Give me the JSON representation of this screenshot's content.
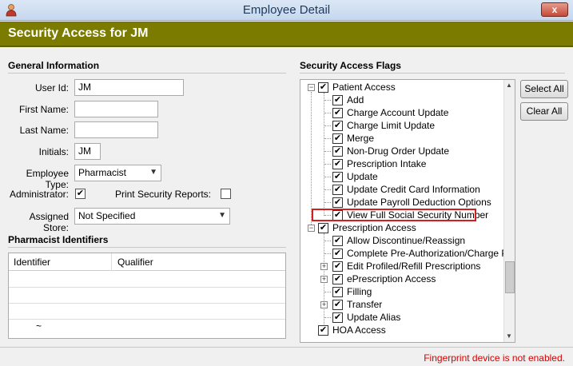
{
  "window": {
    "title": "Employee Detail",
    "close_glyph": "x"
  },
  "header": {
    "title": "Security Access for JM"
  },
  "general": {
    "section_title": "General Information",
    "user_id_label": "User Id:",
    "user_id": "JM",
    "first_name_label": "First Name:",
    "first_name": "",
    "last_name_label": "Last Name:",
    "last_name": "",
    "initials_label": "Initials:",
    "initials": "JM",
    "employee_type_label": "Employee Type:",
    "employee_type": "Pharmacist",
    "administrator_label": "Administrator:",
    "administrator_checked": "✔",
    "print_reports_label": "Print Security Reports:",
    "print_reports_checked": "",
    "assigned_store_label": "Assigned Store:",
    "assigned_store": "Not Specified"
  },
  "identifiers": {
    "section_title": "Pharmacist Identifiers",
    "columns": [
      "Identifier",
      "Qualifier"
    ],
    "new_row_marker": "~"
  },
  "flags": {
    "section_title": "Security Access Flags",
    "check_glyph": "✔",
    "patient_access": {
      "label": "Patient Access",
      "children": [
        "Add",
        "Charge Account Update",
        "Charge Limit Update",
        "Merge",
        "Non-Drug Order Update",
        "Prescription Intake",
        "Update",
        "Update Credit Card Information",
        "Update Payroll Deduction Options",
        "View Full Social Security Number"
      ]
    },
    "prescription_access": {
      "label": "Prescription Access",
      "children": [
        "Allow Discontinue/Reassign",
        "Complete Pre-Authorization/Charge Patie",
        "Edit Profiled/Refill Prescriptions",
        "ePrescription Access",
        "Filling",
        "Transfer",
        "Update Alias"
      ]
    },
    "next_group_label": "HOA Access",
    "select_all": "Select All",
    "clear_all": "Clear All"
  },
  "status": {
    "message": "Fingerprint device is not enabled."
  },
  "colors": {
    "header_band": "#7b7b00",
    "status_text": "#d40000",
    "highlight": "#d21f1f"
  }
}
